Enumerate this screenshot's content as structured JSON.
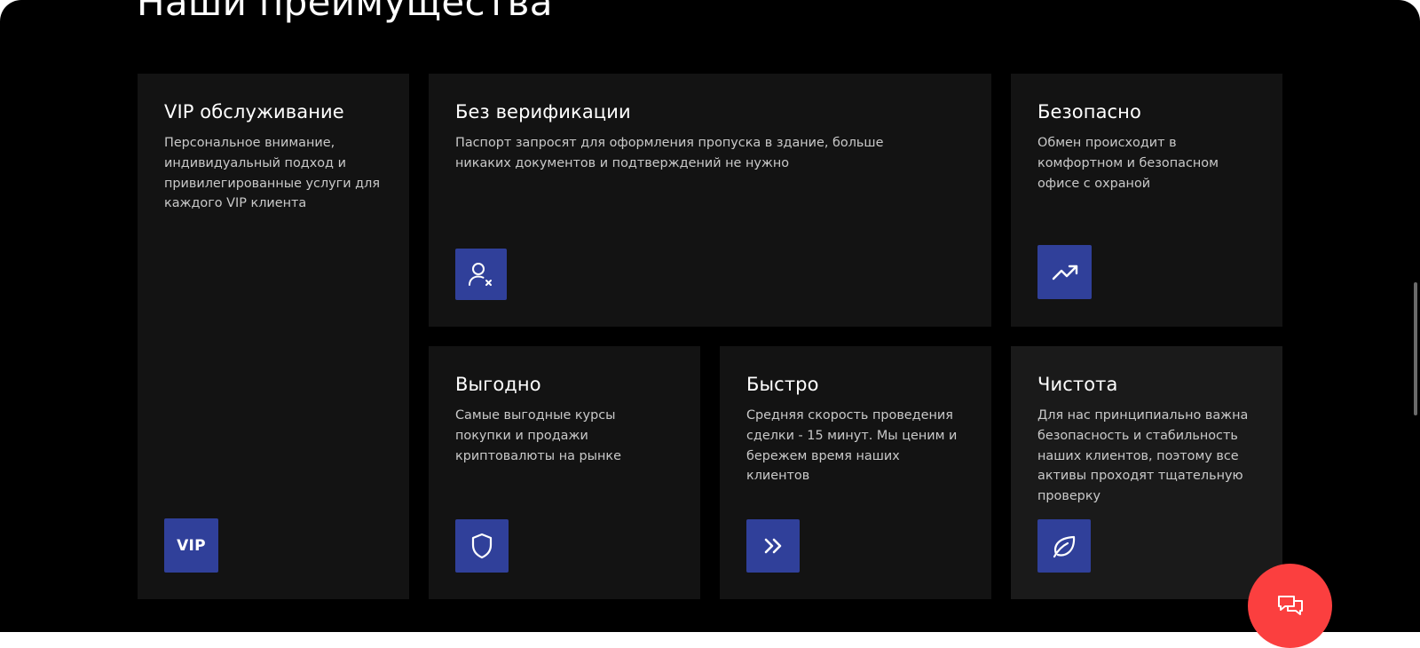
{
  "section": {
    "title": "Наши преимущества"
  },
  "cards": {
    "vip": {
      "title": "VIP обслуживание",
      "text": "Персональное внимание, индивидуальный подход и привилегированные услуги для каждого VIP клиента",
      "icon": "vip-icon",
      "icon_text": "VIP"
    },
    "no_verification": {
      "title": "Без верификации",
      "text": "Паспорт запросят для оформления пропуска в здание, больше никаких документов и подтверждений не нужно",
      "icon": "user-remove-icon"
    },
    "safe": {
      "title": "Безопасно",
      "text": "Обмен происходит в комфортном и безопасном офисе с охраной",
      "icon": "trending-up-icon"
    },
    "profitable": {
      "title": "Выгодно",
      "text": "Самые выгодные курсы покупки и продажи криптовалюты на рынке",
      "icon": "shield-icon"
    },
    "fast": {
      "title": "Быстро",
      "text": "Средняя скорость проведения сделки - 15 минут. Мы ценим и бережем время наших клиентов",
      "icon": "double-chevron-right-icon"
    },
    "clean": {
      "title": "Чистота",
      "text": "Для нас принципиально важна безопасность и стабильность наших клиентов, поэтому все активы проходят тщательную проверку",
      "icon": "leaf-icon"
    }
  },
  "chat_button": {
    "icon": "chat-bubbles-icon"
  },
  "colors": {
    "page_background": "#000000",
    "card_background": "#131313",
    "card_background_alt": "#1a1a1a",
    "icon_background": "#30409a",
    "chat_button": "#fb3f3f",
    "title_text": "#ffffff",
    "body_text": "#c9c9c9"
  }
}
